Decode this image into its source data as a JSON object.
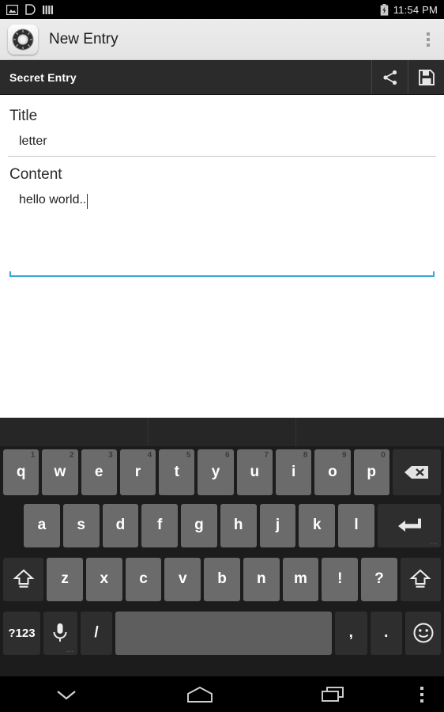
{
  "status_bar": {
    "icons": [
      "image-icon",
      "download-notification-icon",
      "signal-bars-icon"
    ],
    "battery_icon": "battery-charging-icon",
    "time": "11:54 PM"
  },
  "app_bar": {
    "app_icon": "safe-dial-icon",
    "title": "New Entry",
    "overflow_icon": "overflow-menu-icon"
  },
  "action_bar": {
    "title": "Secret Entry",
    "share_icon": "share-icon",
    "save_icon": "save-floppy-icon"
  },
  "form": {
    "title_label": "Title",
    "title_value": "letter",
    "title_placeholder": "Title",
    "content_label": "Content",
    "content_value": "hello world..",
    "content_placeholder": "Content",
    "focus_color": "#3ba6d4",
    "underline_color": "#c9c9c9"
  },
  "keyboard": {
    "suggestion_cells": [
      "",
      "",
      ""
    ],
    "rows": [
      {
        "name": "row-1",
        "keys": [
          {
            "label": "q",
            "num": "1"
          },
          {
            "label": "w",
            "num": "2"
          },
          {
            "label": "e",
            "num": "3"
          },
          {
            "label": "r",
            "num": "4"
          },
          {
            "label": "t",
            "num": "5"
          },
          {
            "label": "y",
            "num": "6"
          },
          {
            "label": "u",
            "num": "7"
          },
          {
            "label": "i",
            "num": "8"
          },
          {
            "label": "o",
            "num": "9"
          },
          {
            "label": "p",
            "num": "0"
          },
          {
            "label": "",
            "icon": "backspace-icon",
            "dark": true
          }
        ]
      },
      {
        "name": "row-2",
        "keys": [
          {
            "label": "a"
          },
          {
            "label": "s"
          },
          {
            "label": "d"
          },
          {
            "label": "f"
          },
          {
            "label": "g"
          },
          {
            "label": "h"
          },
          {
            "label": "j"
          },
          {
            "label": "k"
          },
          {
            "label": "l"
          },
          {
            "label": "",
            "icon": "enter-icon",
            "dark": true,
            "hint": "..."
          }
        ]
      },
      {
        "name": "row-3",
        "keys": [
          {
            "label": "",
            "icon": "shift-icon",
            "dark": true
          },
          {
            "label": "z"
          },
          {
            "label": "x"
          },
          {
            "label": "c"
          },
          {
            "label": "v"
          },
          {
            "label": "b"
          },
          {
            "label": "n"
          },
          {
            "label": "m"
          },
          {
            "label": "!"
          },
          {
            "label": "?"
          },
          {
            "label": "",
            "icon": "shift-icon",
            "dark": true
          }
        ]
      },
      {
        "name": "row-4",
        "keys": [
          {
            "label": "?123",
            "dark": true
          },
          {
            "label": "",
            "icon": "microphone-icon",
            "dark": true,
            "hint": "..."
          },
          {
            "label": "/",
            "dark": true
          },
          {
            "label": "",
            "space": true
          },
          {
            "label": ",",
            "dark": true
          },
          {
            "label": ".",
            "dark": true
          },
          {
            "label": "",
            "icon": "emoji-icon",
            "dark": true
          }
        ]
      }
    ]
  },
  "nav_bar": {
    "back_icon": "hide-keyboard-chevron-icon",
    "home_icon": "home-icon",
    "recents_icon": "recent-apps-icon",
    "menu_icon": "overflow-menu-icon"
  }
}
